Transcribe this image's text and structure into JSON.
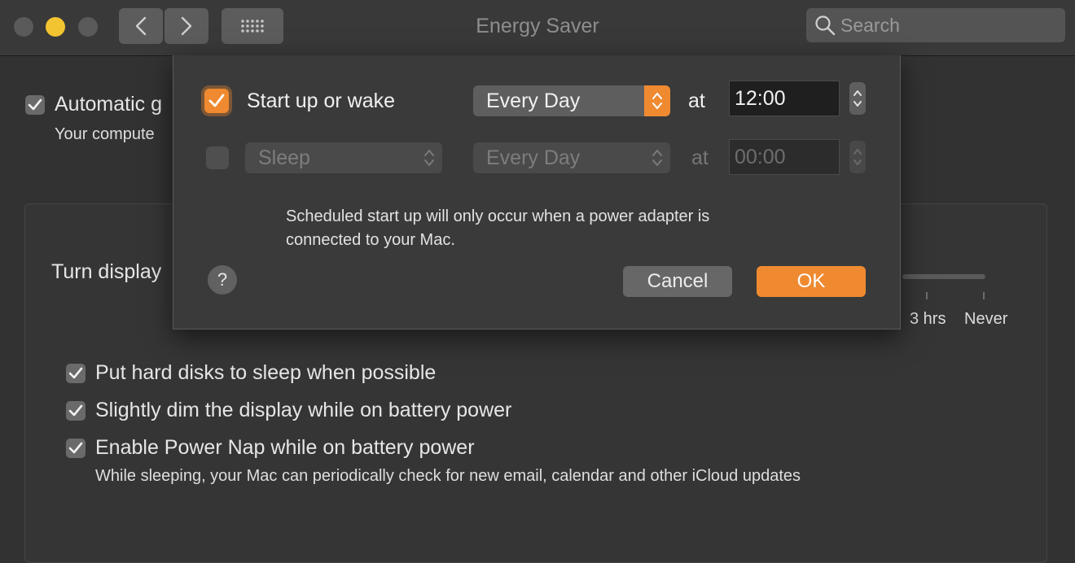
{
  "window": {
    "title": "Energy Saver",
    "search_placeholder": "Search",
    "icons": [
      "back-arrow-icon",
      "forward-arrow-icon",
      "grid-icon",
      "search-icon"
    ]
  },
  "background": {
    "auto_graphics_label": "Automatic g",
    "auto_graphics_checked": true,
    "auto_graphics_sub": "Your compute",
    "turn_display_label": "Turn display",
    "slider_tick_labels": [
      "3 hrs",
      "Never"
    ],
    "options": [
      {
        "label": "Put hard disks to sleep when possible",
        "checked": true
      },
      {
        "label": "Slightly dim the display while on battery power",
        "checked": true
      },
      {
        "label": "Enable Power Nap while on battery power",
        "checked": true
      }
    ],
    "power_nap_sub": "While sleeping, your Mac can periodically check for new email, calendar and other iCloud updates"
  },
  "schedule_sheet": {
    "row1": {
      "checked": true,
      "label": "Start up or wake",
      "frequency": "Every Day",
      "at_label": "at",
      "time": "12:00"
    },
    "row2": {
      "checked": false,
      "action": "Sleep",
      "frequency": "Every Day",
      "at_label": "at",
      "time": "00:00"
    },
    "note_line1": "Scheduled start up will only occur when a power adapter is",
    "note_line2": "connected to your Mac.",
    "help_label": "?",
    "cancel_label": "Cancel",
    "ok_label": "OK"
  },
  "colors": {
    "accent": "#ef8a30",
    "window_bg": "#323232",
    "traffic_yellow": "#f2c432"
  }
}
